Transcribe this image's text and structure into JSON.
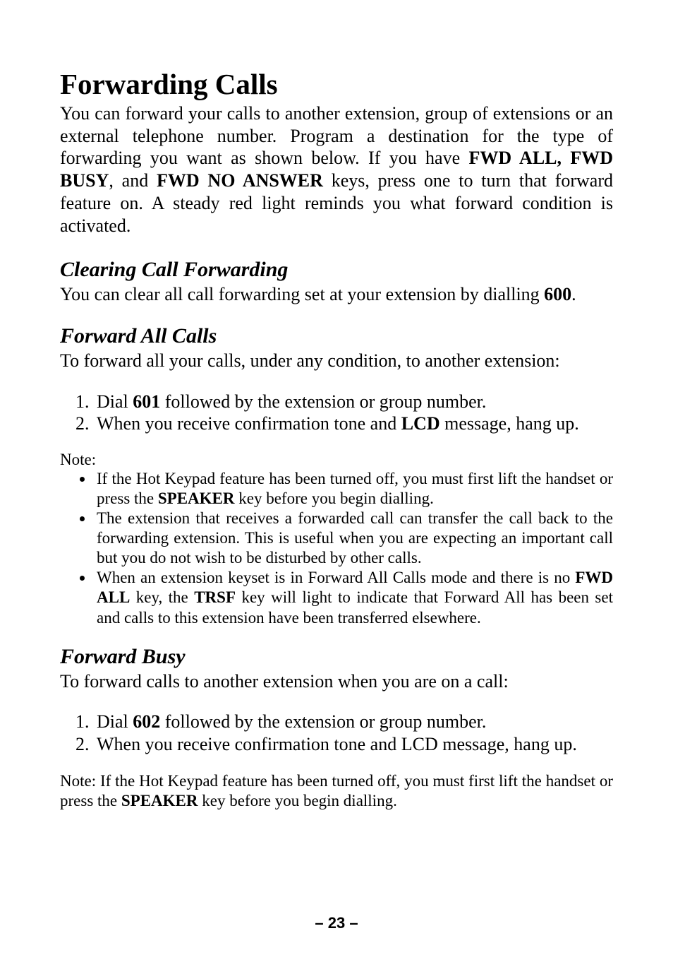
{
  "title": "Forwarding Calls",
  "intro_parts": {
    "p1": "You can forward your calls to another extension, group of extensions or an external telephone number. Program a destination for the type of forwarding you want as shown below. If you have ",
    "b1": "FWD ALL, FWD BUSY",
    "p2": ", and ",
    "b2": "FWD NO ANSWER",
    "p3": " keys, press one to turn that forward feature on. A steady red light reminds you what forward condition is activated."
  },
  "sec_clearing": {
    "heading": "Clearing Call Forwarding",
    "para_parts": {
      "p1": "You can clear all call forwarding set at your extension by dialling ",
      "b1": "600",
      "p2": "."
    }
  },
  "sec_fwd_all": {
    "heading": "Forward All Calls",
    "para": "To forward all your calls, under any condition, to another extension:",
    "steps": {
      "s1": {
        "pre": "Dial ",
        "bold": "601",
        "post": " followed by the extension or group number."
      },
      "s2": {
        "pre": "When you receive confirmation tone and ",
        "sc": "LCD",
        "post": " message, hang up."
      }
    },
    "note_label": "Note:",
    "bullets": {
      "b1": {
        "pre": "If the Hot Keypad feature has been turned off, you must first lift the handset or press the ",
        "sc": "SPEAKER",
        "post": " key before you begin dialling."
      },
      "b2": "The extension that receives a forwarded call can transfer the call back to the forwarding extension. This is useful when you are expecting an important call but you do not wish to be disturbed by other calls.",
      "b3": {
        "pre": "When an extension keyset is in Forward All Calls mode and there is no ",
        "sc1": "FWD ALL",
        "mid": " key, the ",
        "sc2": "TRSF",
        "post": " key will light to indicate that Forward All has been set and calls to this extension have been transferred elsewhere."
      }
    }
  },
  "sec_fwd_busy": {
    "heading": "Forward Busy",
    "para": "To forward calls to another extension when you are on a call:",
    "steps": {
      "s1": {
        "pre": "Dial ",
        "bold": "602",
        "post": " followed by the extension or group number."
      },
      "s2": {
        "pre": "When you receive confirmation tone and ",
        "sc": "LCD",
        "post": " message, hang up."
      }
    },
    "note": {
      "pre": "Note: If the Hot Keypad feature has been turned off, you must first lift the handset or press the ",
      "sc": "SPEAKER",
      "post": " key before you begin dialling."
    }
  },
  "page_number": "– 23 –"
}
